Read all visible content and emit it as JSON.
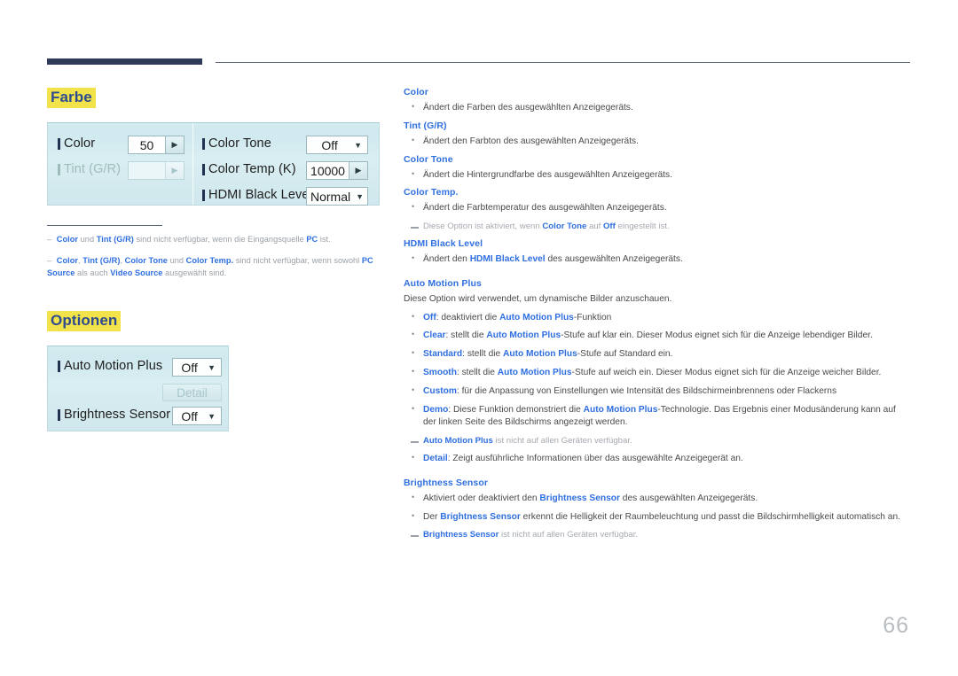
{
  "page": {
    "number": "66"
  },
  "sections": {
    "farbe": {
      "heading": "Farbe"
    },
    "optionen": {
      "heading": "Optionen"
    }
  },
  "osd_color": {
    "left_rows": [
      {
        "label": "Color",
        "value": "50",
        "control": "spinner",
        "enabled": true
      },
      {
        "label": "Tint (G/R)",
        "value": "",
        "control": "spinner",
        "enabled": false
      }
    ],
    "right_rows": [
      {
        "label": "Color Tone",
        "value": "Off",
        "control": "dropdown",
        "enabled": true
      },
      {
        "label": "Color Temp (K)",
        "value": "10000",
        "control": "spinner",
        "enabled": true
      },
      {
        "label": "HDMI Black Level",
        "value": "Normal",
        "control": "dropdown",
        "enabled": true
      }
    ]
  },
  "osd_options": {
    "rows": [
      {
        "label": "Auto Motion Plus",
        "value": "Off",
        "control": "dropdown",
        "enabled": true
      },
      {
        "label": "Brightness Sensor",
        "value": "Off",
        "control": "dropdown",
        "enabled": true
      }
    ],
    "detail_button": {
      "label": "Detail",
      "enabled": false
    }
  },
  "farbe_notes": [
    "<span class=\"dash\">–</span> <b>Color</b> und <b>Tint (G/R)</b> sind nicht verfügbar, wenn die Eingangsquelle <b>PC</b> ist.",
    "<span class=\"dash\">–</span> <b>Color</b>, <b>Tint (G/R)</b>, <b>Color Tone</b> und <b>Color Temp.</b> sind nicht verfügbar, wenn sowohl <b>PC Source</b> als auch <b>Video Source</b> ausgewählt sind."
  ],
  "right_column": [
    {
      "kind": "head",
      "text": "Color"
    },
    {
      "kind": "item",
      "text": "Ändert die Farben des ausgewählten Anzeigegeräts."
    },
    {
      "kind": "head",
      "text": "Tint (G/R)"
    },
    {
      "kind": "item",
      "text": "Ändert den Farbton des ausgewählten Anzeigegeräts."
    },
    {
      "kind": "head",
      "text": "Color Tone"
    },
    {
      "kind": "item",
      "text": "Ändert die Hintergrundfarbe des ausgewählten Anzeigegeräts."
    },
    {
      "kind": "head",
      "text": "Color Temp."
    },
    {
      "kind": "item",
      "text": "Ändert die Farbtemperatur des ausgewählten Anzeigegeräts."
    },
    {
      "kind": "note",
      "text": "Diese Option ist aktiviert, wenn <b>Color Tone</b> auf <b>Off</b> eingestellt ist."
    },
    {
      "kind": "head",
      "text": "HDMI Black Level"
    },
    {
      "kind": "item",
      "text": "Ändert den <b>HDMI Black Level</b> des ausgewählten Anzeigegeräts."
    },
    {
      "kind": "head_sp",
      "text": "Auto Motion Plus"
    },
    {
      "kind": "plain",
      "text": "Diese Option wird verwendet, um dynamische Bilder anzuschauen."
    },
    {
      "kind": "item",
      "text": "<b>Off</b>: deaktiviert die <b>Auto Motion Plus</b>-Funktion"
    },
    {
      "kind": "item",
      "text": "<b>Clear</b>: stellt die <b>Auto Motion Plus</b>-Stufe auf klar ein. Dieser Modus eignet sich für die Anzeige lebendiger Bilder."
    },
    {
      "kind": "item",
      "text": "<b>Standard</b>: stellt die <b>Auto Motion Plus</b>-Stufe auf Standard ein."
    },
    {
      "kind": "item",
      "text": "<b>Smooth</b>: stellt die <b>Auto Motion Plus</b>-Stufe auf weich ein. Dieser Modus eignet sich für die Anzeige weicher Bilder."
    },
    {
      "kind": "item",
      "text": "<b>Custom</b>: für die Anpassung von Einstellungen wie Intensität des Bildschirmeinbrennens oder Flackerns"
    },
    {
      "kind": "item",
      "text": "<b>Demo</b>: Diese Funktion demonstriert die <b>Auto Motion Plus</b>-Technologie. Das Ergebnis einer Modusänderung kann auf der linken Seite des Bildschirms angezeigt werden."
    },
    {
      "kind": "note",
      "text": "<b>Auto Motion Plus</b> ist nicht auf allen Geräten verfügbar."
    },
    {
      "kind": "item",
      "text": "<b>Detail</b>: Zeigt ausführliche Informationen über das ausgewählte Anzeigegerät an."
    },
    {
      "kind": "head_sp",
      "text": "Brightness Sensor"
    },
    {
      "kind": "item",
      "text": "Aktiviert oder deaktiviert den <b>Brightness Sensor</b> des ausgewählten Anzeigegeräts."
    },
    {
      "kind": "item",
      "text": "Der <b>Brightness Sensor</b> erkennt die Helligkeit der Raumbeleuchtung und passt die Bildschirmhelligkeit automatisch an."
    },
    {
      "kind": "note",
      "text": "<b>Brightness Sensor</b> ist nicht auf allen Geräten verfügbar."
    }
  ],
  "colors": {
    "heading_highlight": "#f2e34a",
    "heading_text": "#2f4b8f",
    "link_blue": "#2f6fe0",
    "rule_navy": "#2e3b58",
    "osd_panel": "#d2ecef",
    "page_number": "#b9bcc0"
  }
}
